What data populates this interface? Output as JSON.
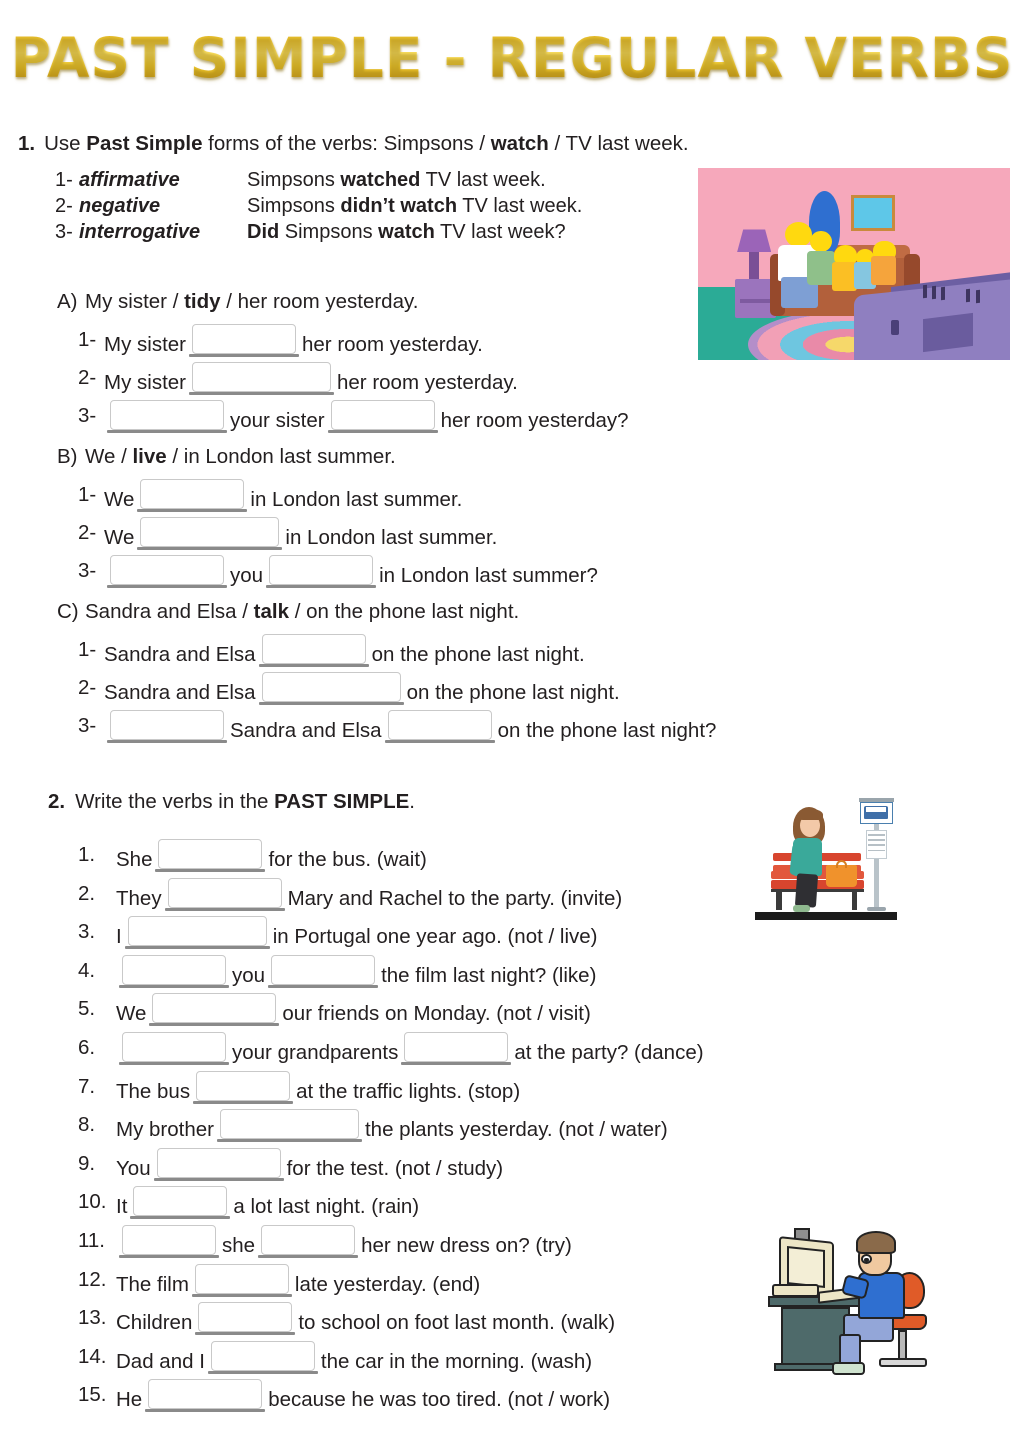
{
  "title": "PAST SIMPLE - REGULAR VERBS",
  "exercise1": {
    "number": "1.",
    "instruction_pre": "Use ",
    "instruction_bold": "Past Simple",
    "instruction_mid": " forms of the verbs:  Simpsons / ",
    "instruction_bold2": "watch",
    "instruction_post": " / TV last week.",
    "examples": [
      {
        "n": "1-",
        "label": "affirmative",
        "pre": "Simpsons ",
        "bold": "watched",
        "post": " TV last week."
      },
      {
        "n": "2-",
        "label": "negative",
        "pre": "Simpsons ",
        "bold": "didn’t watch",
        "post": " TV last week."
      },
      {
        "n": "3-",
        "label": "interrogative",
        "pre": "",
        "bold": "Did",
        "mid": " Simpsons ",
        "bold2": "watch",
        "post": " TV last week?"
      }
    ],
    "items": [
      {
        "letter": "A)",
        "prompt_pre": "My sister / ",
        "prompt_verb": "tidy",
        "prompt_post": " / her room yesterday.",
        "lines": [
          {
            "n": "1-",
            "before": "My sister",
            "after": "her room yesterday.",
            "blank1": "w110"
          },
          {
            "n": "2-",
            "before": "My sister",
            "after": "her room yesterday.",
            "blank1": "w145"
          },
          {
            "n": "3-",
            "before": "",
            "mid": "your sister",
            "after": "her room yesterday?",
            "blank1": "w120",
            "blank2": "w110"
          }
        ]
      },
      {
        "letter": "B)",
        "prompt_pre": "We / ",
        "prompt_verb": "live",
        "prompt_post": " / in London last summer.",
        "lines": [
          {
            "n": "1-",
            "before": "We",
            "after": "in London last summer.",
            "blank1": "w110"
          },
          {
            "n": "2-",
            "before": "We",
            "after": "in London last summer.",
            "blank1": "w145"
          },
          {
            "n": "3-",
            "before": "",
            "mid": "you",
            "after": "in London last summer?",
            "blank1": "w120",
            "blank2": "w110"
          }
        ]
      },
      {
        "letter": "C)",
        "prompt_pre": "Sandra and Elsa / ",
        "prompt_verb": "talk",
        "prompt_post": " / on the phone last night.",
        "lines": [
          {
            "n": "1-",
            "before": "Sandra and Elsa",
            "after": "on the phone last night.",
            "blank1": "w110"
          },
          {
            "n": "2-",
            "before": "Sandra and Elsa",
            "after": "on the phone last night.",
            "blank1": "w145"
          },
          {
            "n": "3-",
            "before": "",
            "mid": "Sandra and Elsa",
            "after": "on the phone last night?",
            "blank1": "w120",
            "blank2": "w110"
          }
        ]
      }
    ]
  },
  "exercise2": {
    "number": "2.",
    "instruction_pre": "Write the verbs in the ",
    "instruction_bold": "PAST SIMPLE",
    "instruction_post": ".",
    "items": [
      {
        "n": "1.",
        "before": "She",
        "after": "for the bus. (wait)",
        "blank1": "w110"
      },
      {
        "n": "2.",
        "before": "They",
        "after": "Mary and Rachel to the party. (invite)",
        "blank1": "w120"
      },
      {
        "n": "3.",
        "before": "I",
        "after": "in Portugal one year ago. (not / live)",
        "blank1": "w145"
      },
      {
        "n": "4.",
        "before": "",
        "mid": "you",
        "after": "the film last night? (like)",
        "blank1": "w110",
        "blank2": "w110"
      },
      {
        "n": "5.",
        "before": "We",
        "after": "our friends on Monday. (not / visit)",
        "blank1": "w130"
      },
      {
        "n": "6.",
        "before": "",
        "mid": "your grandparents",
        "after": "at the party? (dance)",
        "blank1": "w110",
        "blank2": "w110"
      },
      {
        "n": "7.",
        "before": "The bus",
        "after": "at the traffic lights. (stop)",
        "blank1": "w100"
      },
      {
        "n": "8.",
        "before": "My brother",
        "after": "the plants yesterday. (not / water)",
        "blank1": "w145"
      },
      {
        "n": "9.",
        "before": "You",
        "after": "for the test. (not / study)",
        "blank1": "w130"
      },
      {
        "n": "10.",
        "before": "It",
        "after": "a lot last night. (rain)",
        "blank1": "w100"
      },
      {
        "n": "11.",
        "before": "",
        "mid": "she",
        "after": "her new dress on? (try)",
        "blank1": "w100",
        "blank2": "w100"
      },
      {
        "n": "12.",
        "before": "The film",
        "after": "late yesterday. (end)",
        "blank1": "w100"
      },
      {
        "n": "13.",
        "before": "Children",
        "after": "to school on foot last month. (walk)",
        "blank1": "w100"
      },
      {
        "n": "14.",
        "before": "Dad and I",
        "after": "the car in the morning. (wash)",
        "blank1": "w110"
      },
      {
        "n": "15.",
        "before": "He",
        "after": "because he was too tired. (not / work)",
        "blank1": "w120"
      }
    ]
  },
  "images": {
    "simpsons": "simpsons-family-watching-tv-illustration",
    "busstop": "woman-waiting-at-bus-stop-illustration",
    "computer": "tired-man-at-computer-desk-illustration"
  },
  "colors": {
    "title_gold": "#edc72f",
    "text": "#231f20",
    "blank_rule": "#8a8a8a",
    "blank_border": "#c9c9c9"
  }
}
